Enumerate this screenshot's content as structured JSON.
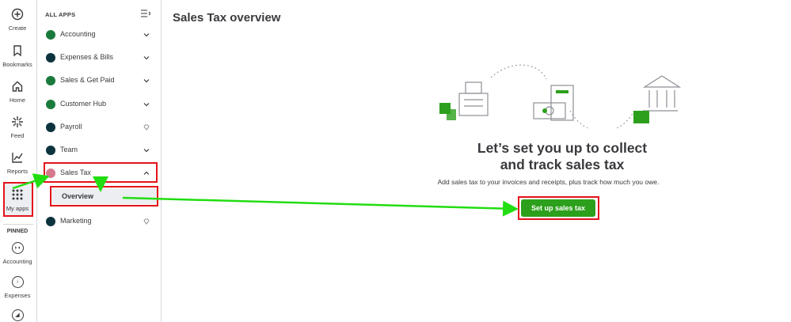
{
  "rail": {
    "items": [
      {
        "label": "Create"
      },
      {
        "label": "Bookmarks"
      },
      {
        "label": "Home"
      },
      {
        "label": "Feed"
      },
      {
        "label": "Reports"
      },
      {
        "label": "My apps"
      }
    ],
    "pinned_label": "PINNED",
    "pinned": [
      {
        "label": "Accounting"
      },
      {
        "label": "Expenses"
      }
    ]
  },
  "apps_panel": {
    "header": "ALL APPS",
    "items": [
      {
        "label": "Accounting"
      },
      {
        "label": "Expenses & Bills"
      },
      {
        "label": "Sales & Get Paid"
      },
      {
        "label": "Customer Hub"
      },
      {
        "label": "Payroll"
      },
      {
        "label": "Team"
      },
      {
        "label": "Sales Tax"
      },
      {
        "label": "Marketing"
      }
    ],
    "subitem": {
      "label": "Overview"
    }
  },
  "main": {
    "title": "Sales Tax overview",
    "hero_title_line1": "Let’s set you up to collect",
    "hero_title_line2": "and track sales tax",
    "hero_subtitle": "Add sales tax to your invoices and receipts, plus track how much you owe.",
    "cta_label": "Set up sales tax"
  },
  "colors": {
    "brand_green": "#2ca01c",
    "annotation_red": "#e3131b",
    "annotation_arrow": "#22dd11",
    "text": "#393a3d"
  }
}
